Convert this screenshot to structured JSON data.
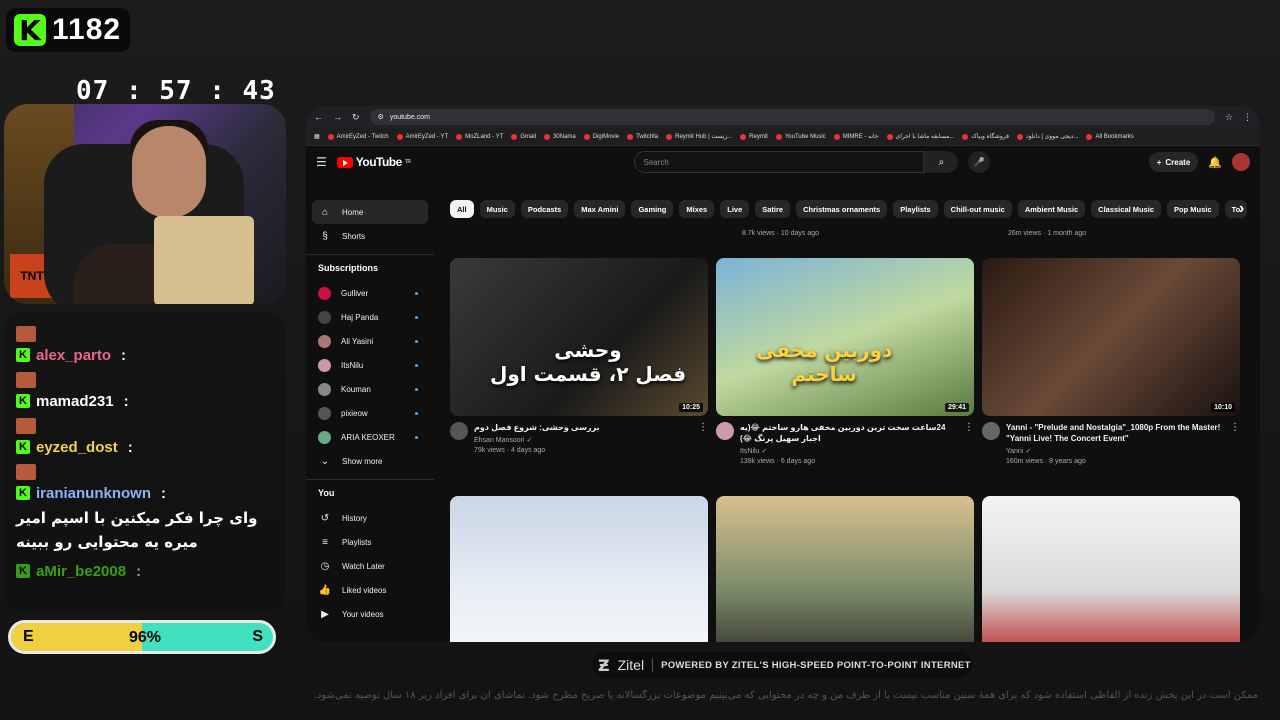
{
  "stream": {
    "kick_count": "1182",
    "timer": "07 : 57 : 43",
    "chat": [
      {
        "name": "alex_parto",
        "color": "#e86a8a",
        "body": ""
      },
      {
        "name": "mamad231",
        "color": "#ffffff",
        "body": ""
      },
      {
        "name": "eyzed_dost",
        "color": "#f3d24a",
        "body": ""
      },
      {
        "name": "iranianunknown",
        "color": "#8ab4f8",
        "body": "وای چرا فکر میکنین با اسپم امیر میره یه محتوایی رو ببینه"
      },
      {
        "name": "aMir_be2008",
        "color": "#53fc18",
        "body": ""
      }
    ],
    "poll": {
      "left": "E",
      "right": "S",
      "percent": "96%",
      "left_fraction": 0.5
    }
  },
  "browser": {
    "url": "youtube.com",
    "bookmarks": [
      "AmirEyZed - Twitch",
      "AmirEyZed - YT",
      "MoZLand - YT",
      "Gmail",
      "30Nama",
      "DigiMovie",
      "Twitchfa",
      "Reymit Hub | زیست...",
      "Reymit",
      "YouTube Music",
      "MIMRE - خانه",
      "مسابقه ماشا با اجرای...",
      "فروشگاه ویباک",
      "دیجی مووی | دانلود...",
      "All Bookmarks"
    ]
  },
  "youtube": {
    "logo": "YouTube",
    "logo_region": "TR",
    "search_placeholder": "Search",
    "create_label": "Create",
    "sidebar": {
      "main": [
        {
          "label": "Home",
          "icon": "home-icon"
        },
        {
          "label": "Shorts",
          "icon": "shorts-icon"
        }
      ],
      "subscriptions_title": "Subscriptions",
      "subscriptions": [
        {
          "label": "Gulliver",
          "color": "#c14"
        },
        {
          "label": "Haj Panda",
          "color": "#444"
        },
        {
          "label": "Ali Yasini",
          "color": "#a77"
        },
        {
          "label": "ItsNilu",
          "color": "#c9a"
        },
        {
          "label": "Kouman",
          "color": "#888"
        },
        {
          "label": "pixieow",
          "color": "#555"
        },
        {
          "label": "ARIA KEOXER",
          "color": "#6a8"
        }
      ],
      "show_more": "Show more",
      "you_title": "You",
      "you": [
        {
          "label": "History",
          "icon": "history-icon"
        },
        {
          "label": "Playlists",
          "icon": "playlists-icon"
        },
        {
          "label": "Watch Later",
          "icon": "clock-icon"
        },
        {
          "label": "Liked videos",
          "icon": "thumbs-up-icon"
        },
        {
          "label": "Your videos",
          "icon": "video-icon"
        }
      ]
    },
    "chips": [
      "All",
      "Music",
      "Podcasts",
      "Max Amini",
      "Gaming",
      "Mixes",
      "Live",
      "Satire",
      "Christmas ornaments",
      "Playlists",
      "Chill-out music",
      "Ambient Music",
      "Classical Music",
      "Pop Music",
      "To"
    ],
    "prev_row_meta": [
      "8.7k views · 10 days ago",
      "26m views · 1 month ago"
    ],
    "videos": [
      {
        "title": "بررسی وحشی: شروع فصل دوم",
        "channel": "Ehsan Mansoori ✓",
        "meta": "79k views · 4 days ago",
        "duration": "10:25",
        "thumb_text": "وحشی\nفصل ۲، قسمت اول",
        "thumb_bg": "linear-gradient(135deg,#3a3a3a,#1a1a1a 60%,#5a4a30)"
      },
      {
        "title": "24ساعت سخت ترین دوربین مخفی هارو ساختم 😂(یه اجبار سهیل پرنگ 😂)",
        "channel": "ItsNilu ✓",
        "meta": "139k views · 6 days ago",
        "duration": "29:41",
        "thumb_text": "دوربین مخفی\nساختم",
        "thumb_bg": "linear-gradient(160deg,#7ab3d6,#c0d9a0 50%,#5a7a40)"
      },
      {
        "title": "Yanni - \"Prelude and Nostalgia\"_1080p From the Master! \"Yanni Live! The Concert Event\"",
        "channel": "Yanni ✓",
        "meta": "160m views · 8 years ago",
        "duration": "10:10",
        "thumb_text": "",
        "thumb_bg": "linear-gradient(135deg,#2a1a12,#6a4a38 50%,#1a1210)"
      },
      {
        "title": "",
        "channel": "",
        "meta": "",
        "duration": "",
        "thumb_text": "",
        "thumb_bg": "linear-gradient(180deg,#c9d6e6,#e8eef5 60%,#f4f6f9)"
      },
      {
        "title": "",
        "channel": "",
        "meta": "",
        "duration": "",
        "thumb_text": "",
        "thumb_bg": "linear-gradient(180deg,#d8c090,#7a8a6a 60%,#3a3a30)"
      },
      {
        "title": "",
        "channel": "",
        "meta": "",
        "duration": "",
        "thumb_text": "",
        "thumb_bg": "linear-gradient(180deg,#f4f4f4,#d9d9d9 60%,#b33)"
      }
    ]
  },
  "footer": {
    "brand": "Zitel",
    "tagline": "POWERED BY ZITEL'S HIGH-SPEED POINT-TO-POINT INTERNET",
    "disclaimer": "ممکن است در این پخش زنده از الفاظی استفاده شود که برای همهٔ سنین مناسب نیست یا از طرف من و چه در محتوایی که می‌بینیم موضوعات بزرگسالانه یا صریح مطرح شود. تماشای آن برای افراد زیر ۱۸ سال توصیه نمی‌شود."
  }
}
